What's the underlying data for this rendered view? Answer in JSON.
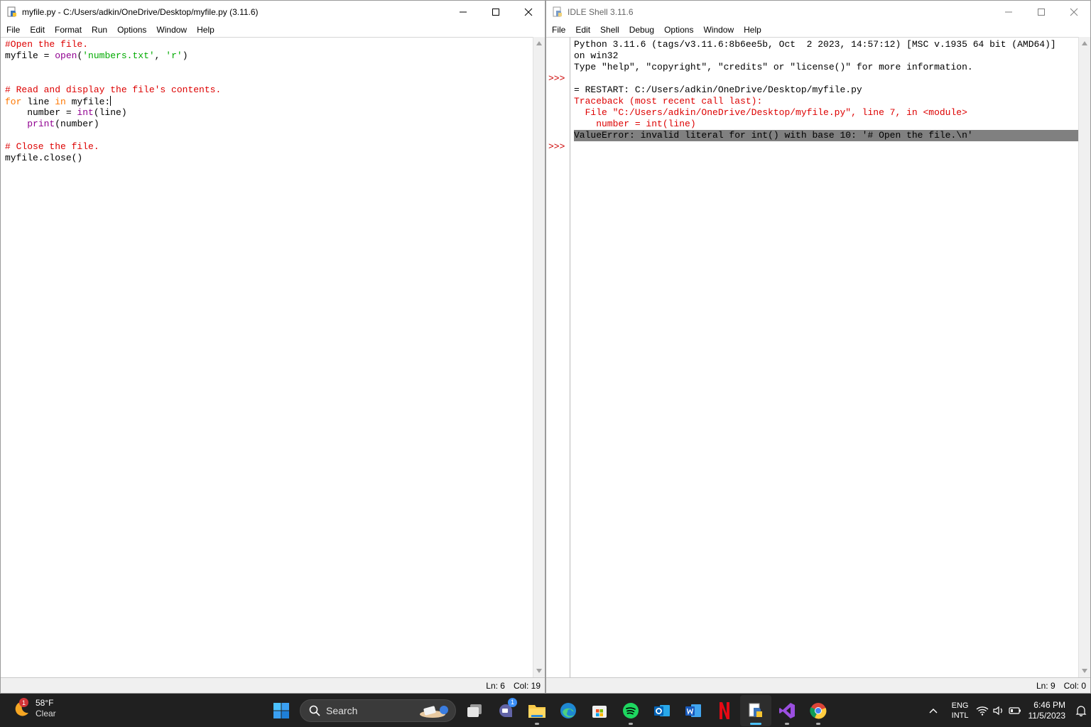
{
  "editor": {
    "title": "myfile.py - C:/Users/adkin/OneDrive/Desktop/myfile.py (3.11.6)",
    "menu": [
      "File",
      "Edit",
      "Format",
      "Run",
      "Options",
      "Window",
      "Help"
    ],
    "lines": [
      [
        {
          "t": "#Open the file.",
          "c": "comment"
        }
      ],
      [
        {
          "t": "myfile = ",
          "c": "def"
        },
        {
          "t": "open",
          "c": "builtin"
        },
        {
          "t": "(",
          "c": "def"
        },
        {
          "t": "'numbers.txt'",
          "c": "string"
        },
        {
          "t": ", ",
          "c": "def"
        },
        {
          "t": "'r'",
          "c": "string"
        },
        {
          "t": ")",
          "c": "def"
        }
      ],
      [],
      [],
      [
        {
          "t": "# Read and display the file's contents.",
          "c": "comment"
        }
      ],
      [
        {
          "t": "for",
          "c": "kw"
        },
        {
          "t": " line ",
          "c": "def"
        },
        {
          "t": "in",
          "c": "kw"
        },
        {
          "t": " myfile:",
          "c": "def"
        },
        {
          "t": "",
          "c": "caret"
        }
      ],
      [
        {
          "t": "    number = ",
          "c": "def"
        },
        {
          "t": "int",
          "c": "builtin"
        },
        {
          "t": "(line)",
          "c": "def"
        }
      ],
      [
        {
          "t": "    ",
          "c": "def"
        },
        {
          "t": "print",
          "c": "builtin"
        },
        {
          "t": "(number)",
          "c": "def"
        }
      ],
      [],
      [
        {
          "t": "# Close the file.",
          "c": "comment"
        }
      ],
      [
        {
          "t": "myfile.close()",
          "c": "def"
        }
      ]
    ],
    "status": {
      "ln": "Ln: 6",
      "col": "Col: 19"
    }
  },
  "shell": {
    "title": "IDLE Shell 3.11.6",
    "menu": [
      "File",
      "Edit",
      "Shell",
      "Debug",
      "Options",
      "Window",
      "Help"
    ],
    "gutter": [
      "",
      "",
      "",
      ">>>",
      "",
      "",
      "",
      "",
      "",
      ">>>"
    ],
    "lines": [
      {
        "t": "Python 3.11.6 (tags/v3.11.6:8b6ee5b, Oct  2 2023, 14:57:12) [MSC v.1935 64 bit (AMD64)]",
        "c": "def"
      },
      {
        "t": "on win32",
        "c": "def"
      },
      {
        "t": "Type \"help\", \"copyright\", \"credits\" or \"license()\" for more information.",
        "c": "def"
      },
      {
        "t": "",
        "c": "def"
      },
      {
        "t": "= RESTART: C:/Users/adkin/OneDrive/Desktop/myfile.py",
        "c": "def"
      },
      {
        "t": "Traceback (most recent call last):",
        "c": "err"
      },
      {
        "t": "  File \"C:/Users/adkin/OneDrive/Desktop/myfile.py\", line 7, in <module>",
        "c": "err"
      },
      {
        "t": "    number = int(line)",
        "c": "err"
      },
      {
        "t": "ValueError: invalid literal for int() with base 10: '# Open the file.\\n'",
        "c": "hl"
      }
    ],
    "status": {
      "ln": "Ln: 9",
      "col": "Col: 0"
    }
  },
  "taskbar": {
    "weather": {
      "temp": "58°F",
      "condition": "Clear",
      "badge": "1"
    },
    "search_label": "Search",
    "apps": [
      {
        "name": "start-icon"
      },
      {
        "name": "task-view-icon"
      },
      {
        "name": "teams-chat-icon",
        "badge": "1"
      },
      {
        "name": "file-explorer-icon",
        "running": true
      },
      {
        "name": "edge-icon"
      },
      {
        "name": "microsoft-store-icon"
      },
      {
        "name": "spotify-icon",
        "running": true
      },
      {
        "name": "outlook-icon"
      },
      {
        "name": "word-icon"
      },
      {
        "name": "netflix-icon"
      },
      {
        "name": "python-idle-icon",
        "running": true,
        "active": true
      },
      {
        "name": "visual-studio-icon",
        "running": true
      },
      {
        "name": "chrome-icon",
        "running": true
      }
    ],
    "language": {
      "line1": "ENG",
      "line2": "INTL"
    },
    "clock": {
      "time": "6:46 PM",
      "date": "11/5/2023"
    }
  }
}
